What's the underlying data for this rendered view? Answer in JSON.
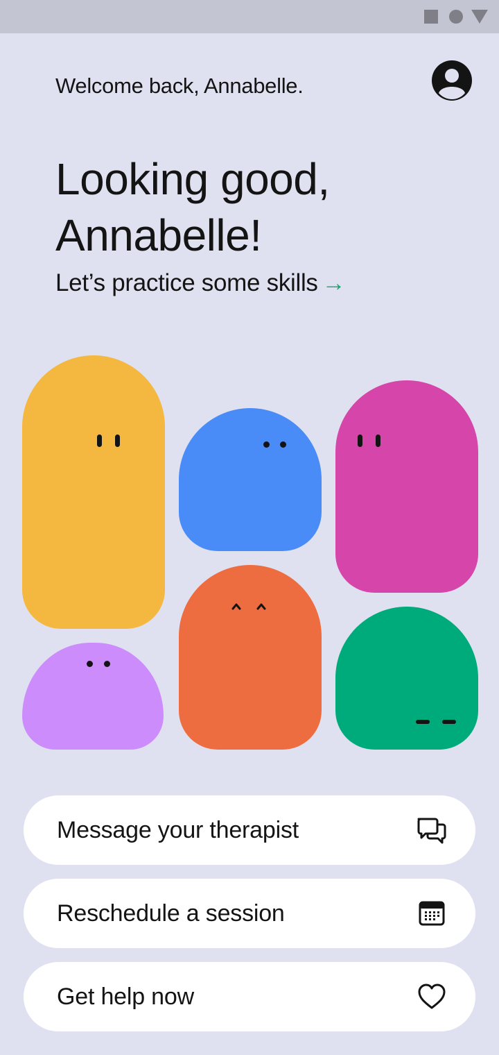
{
  "status_bar": {
    "icons": [
      "stop-square-icon",
      "home-circle-icon",
      "back-triangle-icon"
    ],
    "color": "#7e7f87"
  },
  "header": {
    "welcome": "Welcome back, Annabelle.",
    "avatar_icon": "user-avatar-icon"
  },
  "hero": {
    "headline": "Looking good, Annabelle!",
    "practice_link": "Let’s practice some skills",
    "practice_arrow": "→",
    "accent_color": "#13a86b"
  },
  "characters": [
    {
      "name": "yellow",
      "color": "#f4b740",
      "expression": "eyes-open"
    },
    {
      "name": "blue",
      "color": "#4a8cf7",
      "expression": "eyes-dots"
    },
    {
      "name": "pink",
      "color": "#d545aa",
      "expression": "eyes-open"
    },
    {
      "name": "purple",
      "color": "#cc8cfc",
      "expression": "eyes-dots"
    },
    {
      "name": "orange",
      "color": "#ed6d40",
      "expression": "happy-closed"
    },
    {
      "name": "green",
      "color": "#00ab7b",
      "expression": "eyes-closed"
    }
  ],
  "actions": [
    {
      "label": "Message your therapist",
      "icon": "chat-bubbles-icon"
    },
    {
      "label": "Reschedule a session",
      "icon": "calendar-icon"
    },
    {
      "label": "Get help now",
      "icon": "heart-icon"
    }
  ],
  "colors": {
    "background": "#e0e1f0",
    "status_bar": "#c3c5d2",
    "text": "#141414",
    "card": "#ffffff"
  }
}
